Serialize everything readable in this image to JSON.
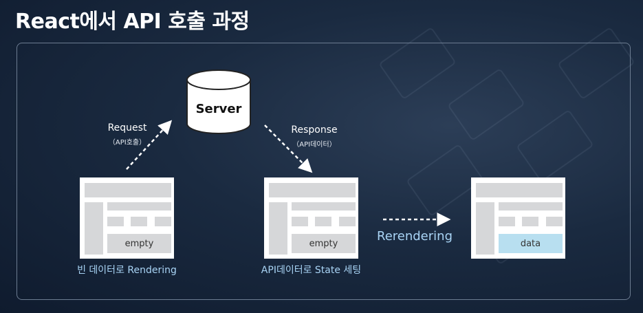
{
  "title": "React에서 API 호출 과정",
  "server": {
    "label": "Server"
  },
  "request": {
    "label": "Request",
    "sublabel": "（API호출）"
  },
  "response": {
    "label": "Response",
    "sublabel": "（API데이터）"
  },
  "cards": [
    {
      "content": "empty",
      "caption": "빈 데이터로 Rendering",
      "highlight": false
    },
    {
      "content": "empty",
      "caption": "API데이터로 State 세팅",
      "highlight": false
    },
    {
      "content": "data",
      "caption": "",
      "highlight": true
    }
  ],
  "rerender": {
    "label": "Rerendering"
  },
  "colors": {
    "accent_text": "#a9d4f5",
    "data_fill": "#b8dff0",
    "placeholder": "#d6d7d9"
  }
}
